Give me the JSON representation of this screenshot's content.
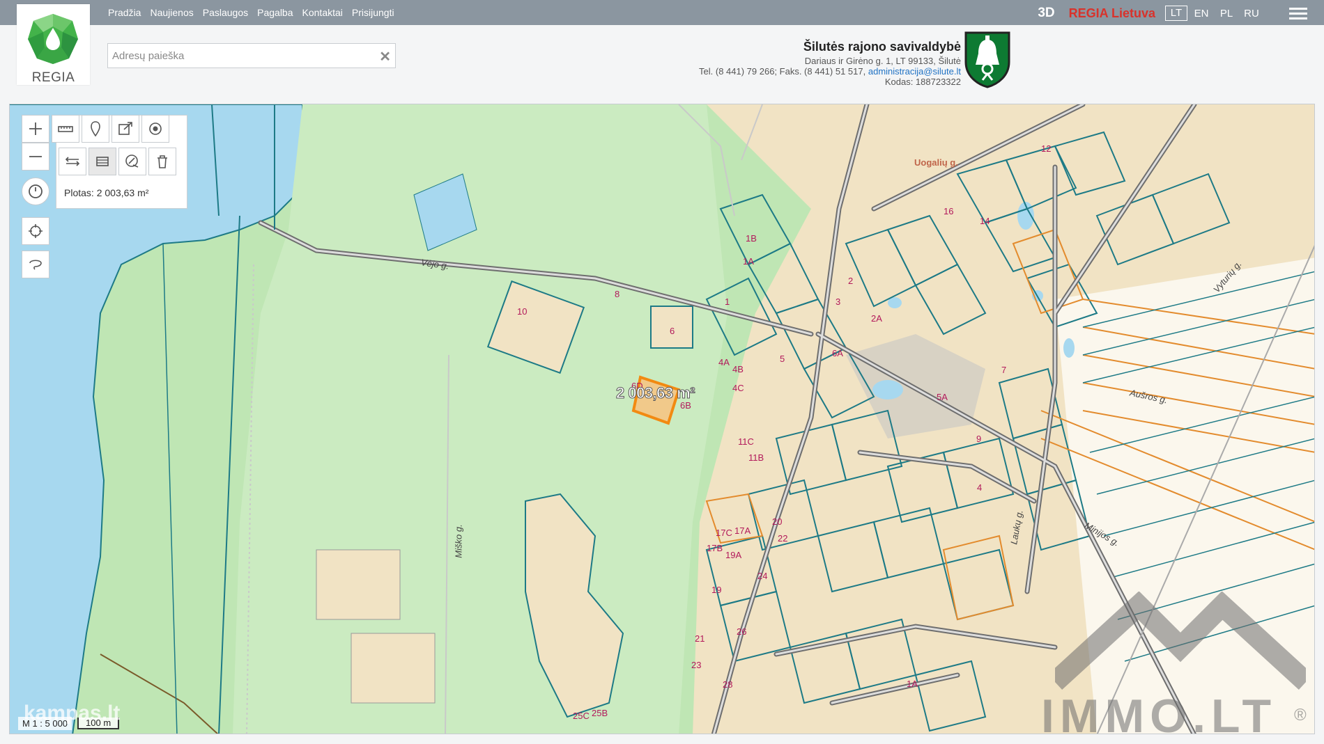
{
  "nav": [
    "Pradžia",
    "Naujienos",
    "Paslaugos",
    "Pagalba",
    "Kontaktai",
    "Prisijungti"
  ],
  "topright": {
    "btn3d": "3D",
    "regia": "REGIA Lietuva",
    "langs": [
      "LT",
      "EN",
      "PL",
      "RU"
    ],
    "active_lang": "LT"
  },
  "logo": {
    "text": "REGIA"
  },
  "search": {
    "placeholder": "Adresų paieška",
    "value": ""
  },
  "municipality": {
    "name": "Šilutės rajono savivaldybė",
    "address": "Dariaus ir Girėno g. 1, LT 99133, Šilutė",
    "phone": "Tel. (8 441) 79 266; Faks. (8 441) 51 517,",
    "email": "administracija@silute.lt",
    "code": "Kodas: 188723322"
  },
  "tools": {
    "area_result": "Plotas: 2 003,63 m²",
    "icons": [
      "zoom-in",
      "zoom-out",
      "history",
      "locate",
      "select-area",
      "measure-ruler",
      "place-marker",
      "export",
      "target",
      "distance",
      "area-measure",
      "clear-measure",
      "delete"
    ]
  },
  "map": {
    "measurement_label": "2 003,63 m²",
    "streets": [
      "Vėjo g.",
      "Miško g.",
      "Uogalių g.",
      "Aušros g.",
      "Minijos g.",
      "Laukų g.",
      "Vyturių g."
    ],
    "plot_numbers": [
      "10",
      "8",
      "6",
      "6D",
      "6B",
      "1B",
      "1A",
      "1",
      "4A",
      "4B",
      "4C",
      "5",
      "3",
      "2",
      "2A",
      "6A",
      "14",
      "12",
      "16",
      "11C",
      "11B",
      "17C",
      "17A",
      "17B",
      "19",
      "19A",
      "20",
      "22",
      "24",
      "26",
      "21",
      "23",
      "28",
      "25C",
      "25B",
      "5A",
      "4",
      "7",
      "9",
      "1A"
    ],
    "scale_ratio": "M 1 : 5 000",
    "scale_bar": "100 m",
    "watermark_left": "kampas.lt",
    "watermark_right": "IMMO.LT",
    "watermark_reg": "®"
  },
  "colors": {
    "topbar": "#8b96a0",
    "map_green": "#bfe6b4",
    "parcel_stroke": "#1d7a86",
    "parcel_fill": "#f1e3c4",
    "road": "#6e6e6e",
    "water": "#a7d8ef",
    "accent_red": "#d9322b"
  }
}
